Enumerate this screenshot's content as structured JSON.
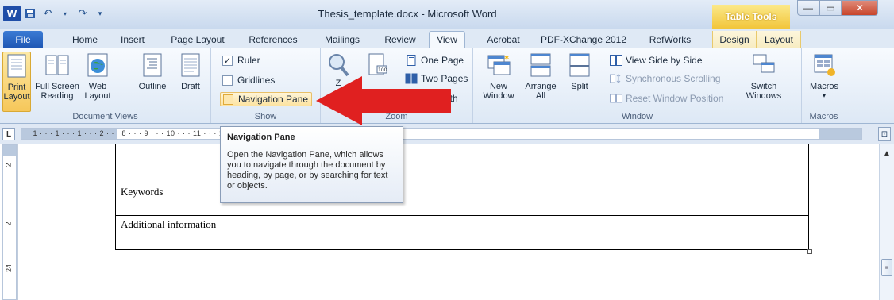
{
  "window": {
    "title": "Thesis_template.docx - Microsoft Word",
    "contextual_tab_group": "Table Tools",
    "app_icon": "W"
  },
  "colors": {
    "file_tab": "#1f58b5",
    "table_tools": "#f2c53a",
    "callout_arrow": "#e02020",
    "selected_button": "#f6c75a"
  },
  "quick_access": {
    "items": [
      "save-icon",
      "undo-icon",
      "redo-icon",
      "customize-icon"
    ]
  },
  "tabs": {
    "file": "File",
    "home": "Home",
    "insert": "Insert",
    "page_layout": "Page Layout",
    "references": "References",
    "mailings": "Mailings",
    "review": "Review",
    "view": "View",
    "acrobat": "Acrobat",
    "pdfxchange": "PDF-XChange 2012",
    "refworks": "RefWorks",
    "design": "Design",
    "layout": "Layout",
    "active": "View"
  },
  "ribbon": {
    "document_views": {
      "label": "Document Views",
      "print_layout": [
        "Print",
        "Layout"
      ],
      "full_screen": [
        "Full Screen",
        "Reading"
      ],
      "web_layout": [
        "Web",
        "Layout"
      ],
      "outline": "Outline",
      "draft": "Draft"
    },
    "show": {
      "label": "Show",
      "ruler": {
        "text": "Ruler",
        "checked": true
      },
      "gridlines": {
        "text": "Gridlines",
        "checked": false
      },
      "navigation_pane": {
        "text": "Navigation Pane",
        "checked": false
      }
    },
    "zoom": {
      "label": "Zoom",
      "zoom_btn": "Z",
      "hundred": "100",
      "one_page": "One Page",
      "two_pages": "Two Pages",
      "page_width": "e Width"
    },
    "window": {
      "label": "Window",
      "new_window": [
        "New",
        "Window"
      ],
      "arrange_all": [
        "Arrange",
        "All"
      ],
      "split": "Split",
      "view_side_by_side": "View Side by Side",
      "sync_scrolling": "Synchronous Scrolling",
      "reset_position": "Reset Window Position",
      "switch_windows": [
        "Switch",
        "Windows"
      ]
    },
    "macros": {
      "label": "Macros",
      "macros_btn": "Macros"
    }
  },
  "ruler": {
    "tab_selector": "L",
    "marks": "· 1 · · · 1 · · · 1 · · · 2 · · · 8 · · · 9 · · · 10 · · · 11 · · · 12 · · · 13 · · · 14 · · · 15 · · · 16 · · · 17 · · · 18 · · ·",
    "vertical_marks": [
      "2",
      "2",
      "24"
    ]
  },
  "tooltip": {
    "title": "Navigation Pane",
    "description": "Open the Navigation Pane, which allows you to navigate through the document by heading, by page, or by searching for text or objects."
  },
  "document": {
    "rows": [
      "",
      "Keywords",
      "Additional information"
    ]
  }
}
